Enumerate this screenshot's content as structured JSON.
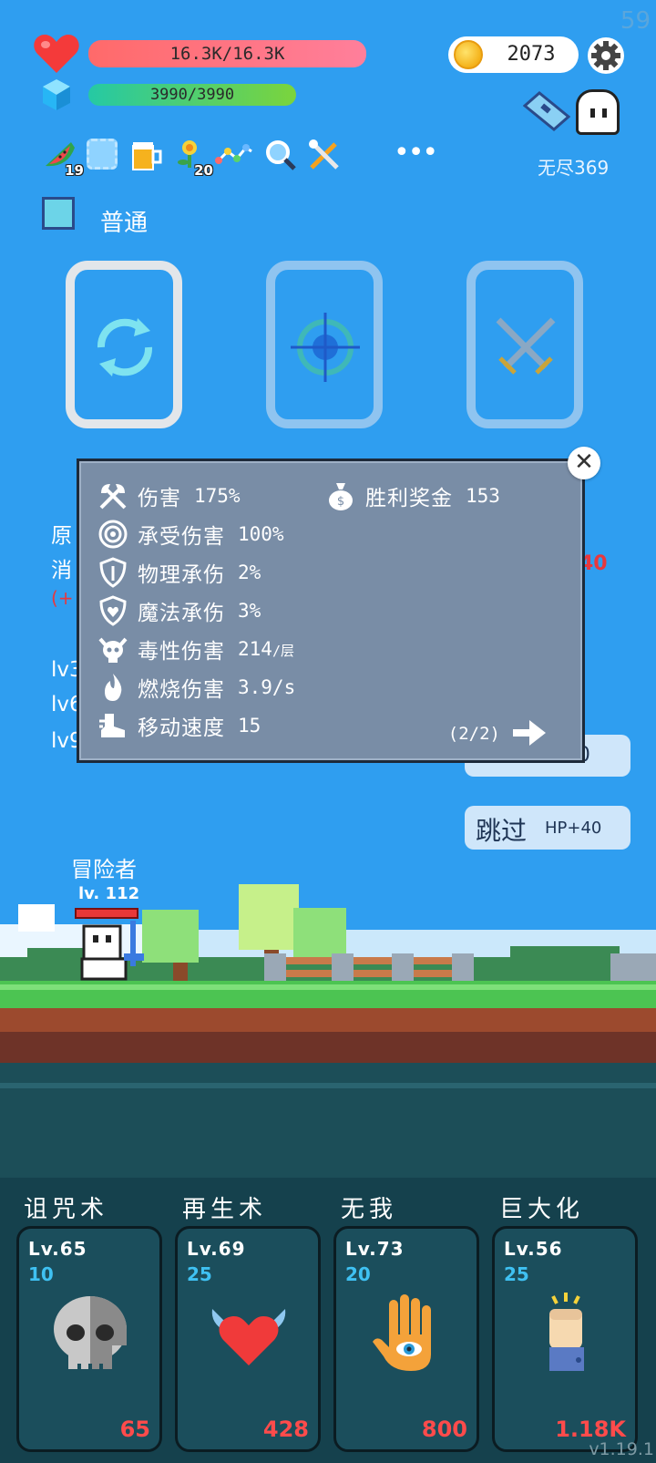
{
  "fps": "59",
  "hud": {
    "hp_text": "16.3K/16.3K",
    "mp_text": "3990/3990",
    "gold": "2073",
    "endless_label": "无尽369"
  },
  "buffs": [
    {
      "icon": "watermelon-icon",
      "count": "19"
    },
    {
      "icon": "empty-slot-icon",
      "count": ""
    },
    {
      "icon": "beer-icon",
      "count": ""
    },
    {
      "icon": "flower-icon",
      "count": "20"
    },
    {
      "icon": "chain-icon",
      "count": ""
    },
    {
      "icon": "magnifier-icon",
      "count": ""
    },
    {
      "icon": "tools-icon",
      "count": ""
    }
  ],
  "more_label": "•••",
  "mode_label": "普通",
  "slots": [
    {
      "icon": "cycle-icon"
    },
    {
      "icon": "target-icon"
    },
    {
      "icon": "crossed-swords-icon"
    }
  ],
  "background": {
    "left_lines": [
      "原",
      "消",
      "(+"
    ],
    "levels": [
      "lv3",
      "lv6",
      "lv9"
    ],
    "right_number": "40",
    "hidden_button": "刷新金币-10",
    "skip_button": {
      "label": "跳过",
      "bonus": "HP+40"
    }
  },
  "popup": {
    "stats": [
      {
        "icon": "axes-icon",
        "name": "伤害",
        "value": "175%",
        "unit": ""
      },
      {
        "icon": "target-rings-icon",
        "name": "承受伤害",
        "value": "100%",
        "unit": ""
      },
      {
        "icon": "shield-icon",
        "name": "物理承伤",
        "value": "2%",
        "unit": ""
      },
      {
        "icon": "magic-shield-icon",
        "name": "魔法承伤",
        "value": "3%",
        "unit": ""
      },
      {
        "icon": "poison-skull-icon",
        "name": "毒性伤害",
        "value": "214",
        "unit": "/层"
      },
      {
        "icon": "fire-icon",
        "name": "燃烧伤害",
        "value": "3.9/s",
        "unit": ""
      },
      {
        "icon": "boot-icon",
        "name": "移动速度",
        "value": "15",
        "unit": ""
      }
    ],
    "reward": {
      "icon": "money-bag-icon",
      "name": "胜利奖金",
      "value": "153"
    },
    "page": "(2/2)",
    "close": "✕"
  },
  "hero": {
    "name": "冒险者",
    "level": "lv. 112"
  },
  "skills": [
    {
      "title": "诅咒术",
      "level": "Lv.65",
      "mana": "10",
      "cost": "65",
      "icon": "skull-icon"
    },
    {
      "title": "再生术",
      "level": "Lv.69",
      "mana": "25",
      "cost": "428",
      "icon": "winged-heart-icon"
    },
    {
      "title": "无我",
      "level": "Lv.73",
      "mana": "20",
      "cost": "800",
      "icon": "eye-hand-icon"
    },
    {
      "title": "巨大化",
      "level": "Lv.56",
      "mana": "25",
      "cost": "1.18K",
      "icon": "fist-icon"
    }
  ],
  "version": "v1.19.1",
  "colors": {
    "sky": "#2f9ef0",
    "hp": "#ff6a6a",
    "mp": "#25c9a4",
    "popup": "#798da6",
    "panel": "#15414d",
    "cost": "#ff4b4b",
    "mana": "#3fc1f2"
  }
}
